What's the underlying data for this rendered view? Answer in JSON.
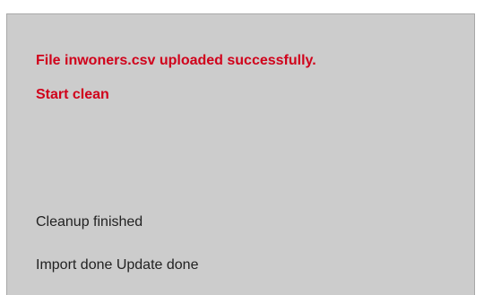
{
  "colors": {
    "alert_text": "#d0021b",
    "normal_text": "#222222",
    "panel_bg": "#cccccc",
    "panel_border": "#a8a8a8"
  },
  "status_panel": {
    "upload_message": "File inwoners.csv uploaded successfully.",
    "start_message": "Start clean",
    "cleanup_message": "Cleanup finished",
    "import_message": "Import done Update done"
  }
}
